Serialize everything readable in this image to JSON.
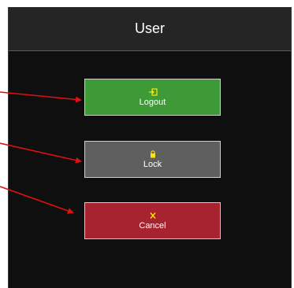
{
  "dialog": {
    "title": "User"
  },
  "buttons": {
    "logout": {
      "label": "Logout",
      "icon": "logout-icon",
      "color": "#3d9a36"
    },
    "lock": {
      "label": "Lock",
      "icon": "lock-icon",
      "color": "#5f5f5f"
    },
    "cancel": {
      "label": "Cancel",
      "icon": "close-icon",
      "color": "#a7232f"
    }
  },
  "colors": {
    "icon_accent": "#ffe600",
    "annotation_arrow": "#e01010",
    "dialog_background": "#0f0f0f",
    "header_background": "#252525"
  }
}
